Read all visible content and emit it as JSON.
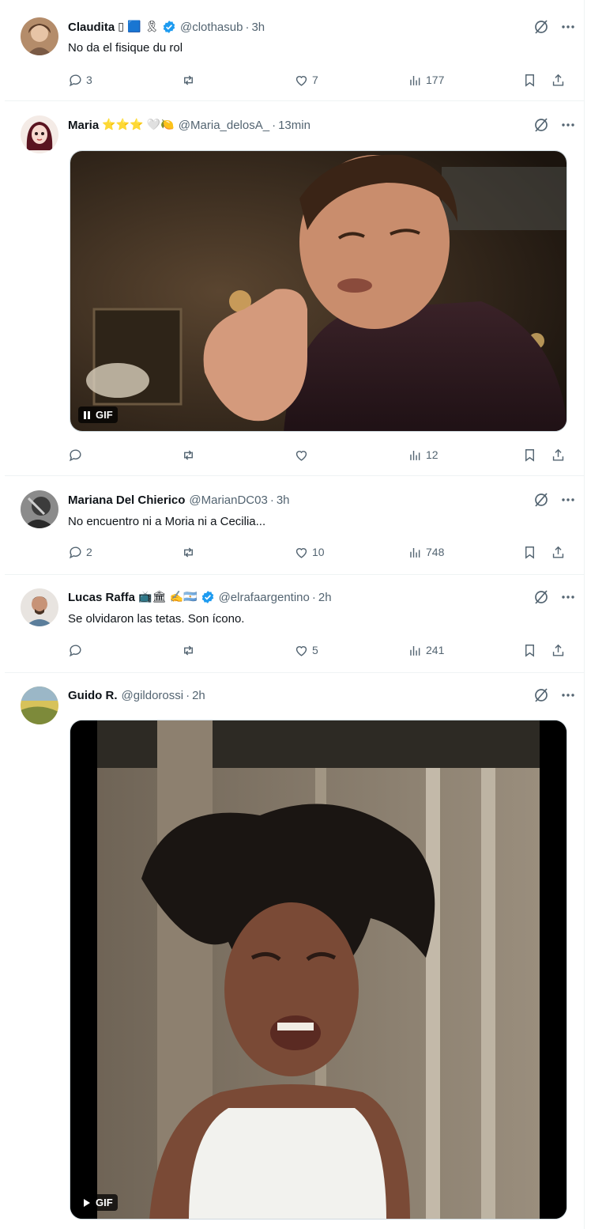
{
  "tweets": [
    {
      "name": "Claudita",
      "emoji": "▯ 🟦 🎗",
      "handle": "@clothasub",
      "time": "3h",
      "text": "No da el fisique du rol",
      "reply_count": "3",
      "retweet_count": "",
      "like_count": "7",
      "views": "177"
    },
    {
      "name": "Maria",
      "emoji": "⭐⭐⭐ 🤍🍋",
      "handle": "@Maria_delosA_",
      "time": "13min",
      "text": "",
      "media": "GIF",
      "reply_count": "",
      "retweet_count": "",
      "like_count": "",
      "views": "12"
    },
    {
      "name": "Mariana Del Chierico",
      "emoji": "",
      "handle": "@MarianDC03",
      "time": "3h",
      "text": "No encuentro ni a Moria ni a Cecilia...",
      "reply_count": "2",
      "retweet_count": "",
      "like_count": "10",
      "views": "748"
    },
    {
      "name": "Lucas Raffa",
      "emoji": "📺🏛 ✍️🇦🇷",
      "handle": "@elrafaargentino",
      "time": "2h",
      "text": "Se olvidaron las tetas. Son ícono.",
      "reply_count": "",
      "retweet_count": "",
      "like_count": "5",
      "views": "241"
    },
    {
      "name": "Guido R.",
      "emoji": "",
      "handle": "@gildorossi",
      "time": "2h",
      "text": "",
      "media": "GIF"
    }
  ],
  "separator": "·",
  "colors": {
    "text": "#0f1419",
    "secondary": "#536471",
    "verified": "#1d9bf0",
    "border": "#eff3f4"
  },
  "icons": [
    "reply-icon",
    "retweet-icon",
    "like-icon",
    "views-icon",
    "bookmark-icon",
    "share-icon",
    "grok-icon",
    "more-icon",
    "verified-icon",
    "pause-icon",
    "play-icon"
  ]
}
